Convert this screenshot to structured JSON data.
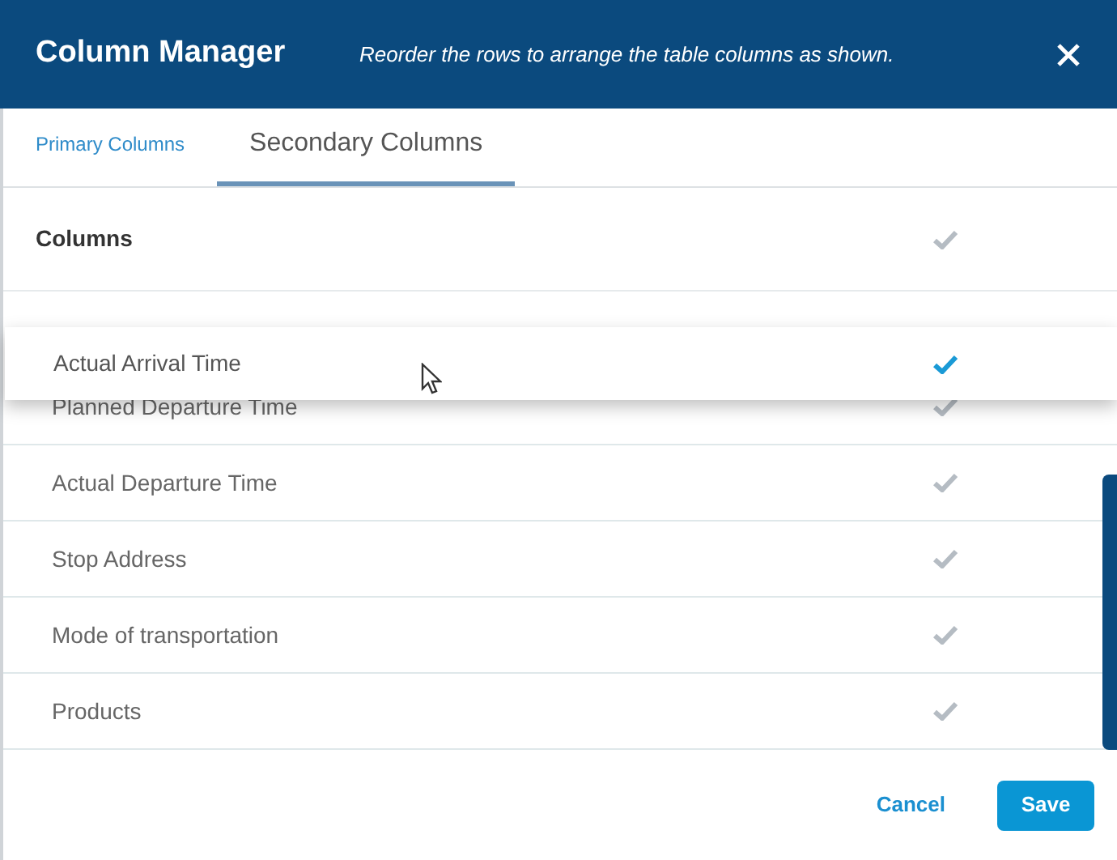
{
  "header": {
    "title": "Column Manager",
    "hint": "Reorder the rows to arrange the table columns as shown."
  },
  "tabs": [
    {
      "label": "Primary Columns",
      "selected": false
    },
    {
      "label": "Secondary Columns",
      "selected": true
    }
  ],
  "list_header": {
    "label": "Columns",
    "checked": true
  },
  "dragged_row": {
    "label": "Actual Arrival Time",
    "checked": true
  },
  "rows": [
    {
      "label": "Planned Departure Time",
      "checked": true
    },
    {
      "label": "Actual Departure Time",
      "checked": true
    },
    {
      "label": "Stop Address",
      "checked": true
    },
    {
      "label": "Mode of transportation",
      "checked": true
    },
    {
      "label": "Products",
      "checked": true
    }
  ],
  "footer": {
    "cancel": "Cancel",
    "save": "Save"
  }
}
